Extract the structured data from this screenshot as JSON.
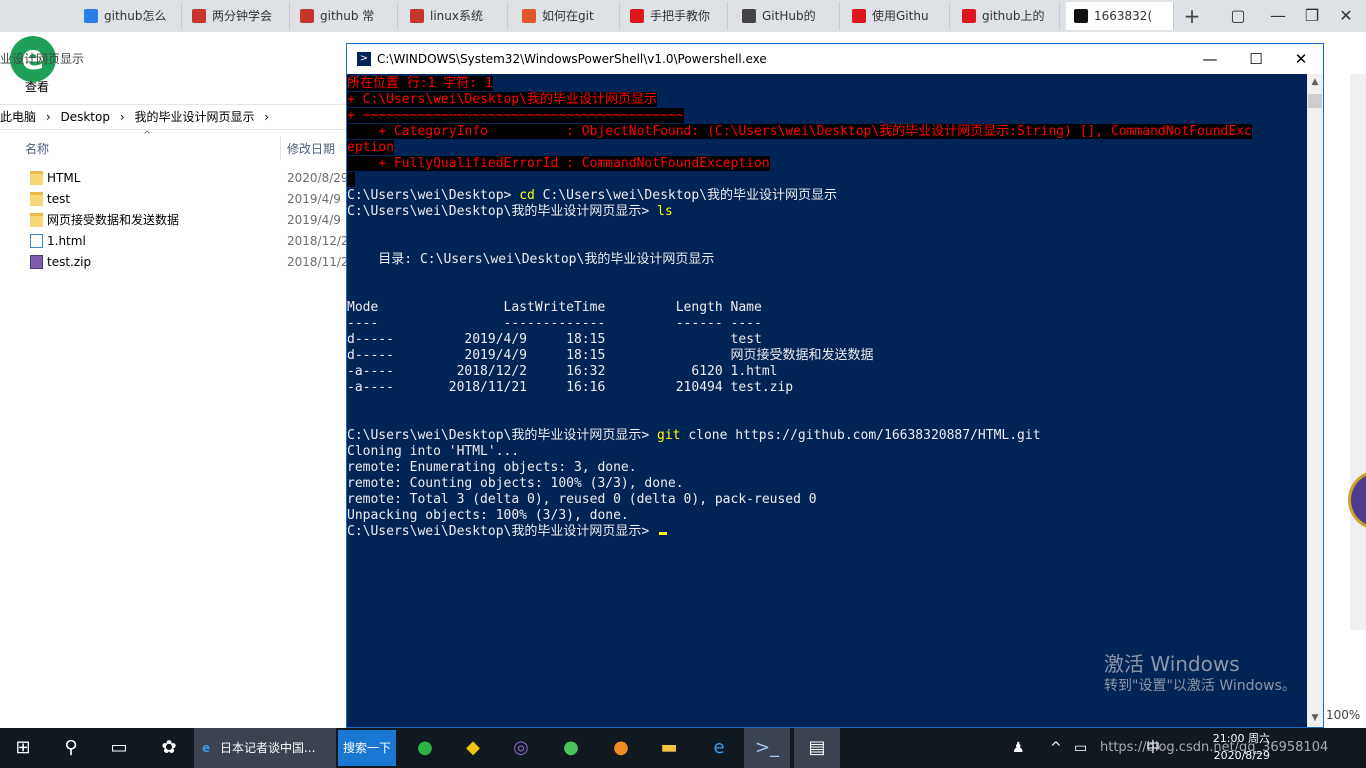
{
  "browser": {
    "tabs": [
      {
        "label": "github怎么",
        "color": "#2b7de9"
      },
      {
        "label": "两分钟学会",
        "color": "#c7372f"
      },
      {
        "label": "github 常",
        "color": "#c7372f"
      },
      {
        "label": "linux系统",
        "color": "#c7372f"
      },
      {
        "label": "如何在git",
        "color": "#e0582a"
      },
      {
        "label": "手把手教你",
        "color": "#e0161e"
      },
      {
        "label": "GitHub的",
        "color": "#444444"
      },
      {
        "label": "使用Githu",
        "color": "#e0161e"
      },
      {
        "label": "github上的",
        "color": "#e0161e"
      },
      {
        "label": "1663832(",
        "color": "#111111"
      }
    ],
    "new_tab": "+"
  },
  "explorer": {
    "title": "业设计网页显示",
    "ribbon_view": "查看",
    "breadcrumb": [
      "此电脑",
      "›",
      "Desktop",
      "›",
      "我的毕业设计网页显示",
      "›"
    ],
    "col_name": "名称",
    "col_date": "修改日期",
    "files": [
      {
        "name": "HTML",
        "date": "2020/8/29",
        "type": "folder"
      },
      {
        "name": "test",
        "date": "2019/4/9",
        "type": "folder"
      },
      {
        "name": "网页接受数据和发送数据",
        "date": "2019/4/9",
        "type": "folder"
      },
      {
        "name": "1.html",
        "date": "2018/12/2",
        "type": "html"
      },
      {
        "name": "test.zip",
        "date": "2018/11/2",
        "type": "zip"
      }
    ]
  },
  "powershell": {
    "title": "C:\\WINDOWS\\System32\\WindowsPowerShell\\v1.0\\Powershell.exe",
    "lines": [
      {
        "t": "所在位置 行:1 字符: 1",
        "k": "err"
      },
      {
        "t": "+ C:\\Users\\wei\\Desktop\\我的毕业设计网页显示",
        "k": "err"
      },
      {
        "t": "+ ~~~~~~~~~~~~~~~~~~~~~~~~~~~~~~~~~~~~~~~~~",
        "k": "err"
      },
      {
        "t": "    + CategoryInfo          : ObjectNotFound: (C:\\Users\\wei\\Desktop\\我的毕业设计网页显示:String) [], CommandNotFoundExc",
        "k": "err"
      },
      {
        "t": "eption",
        "k": "err"
      },
      {
        "t": "    + FullyQualifiedErrorId : CommandNotFoundException",
        "k": "err"
      },
      {
        "t": " ",
        "k": "err"
      },
      {
        "t": "",
        "k": "prompt",
        "p": "C:\\Users\\wei\\Desktop> ",
        "c": "cd",
        "a": " C:\\Users\\wei\\Desktop\\我的毕业设计网页显示"
      },
      {
        "t": "",
        "k": "prompt",
        "p": "C:\\Users\\wei\\Desktop\\我的毕业设计网页显示> ",
        "c": "ls",
        "a": ""
      },
      {
        "t": "",
        "k": "out"
      },
      {
        "t": "",
        "k": "out"
      },
      {
        "t": "    目录: C:\\Users\\wei\\Desktop\\我的毕业设计网页显示",
        "k": "out"
      },
      {
        "t": "",
        "k": "out"
      },
      {
        "t": "",
        "k": "out"
      },
      {
        "t": "Mode                LastWriteTime         Length Name",
        "k": "out"
      },
      {
        "t": "----                -------------         ------ ----",
        "k": "out"
      },
      {
        "t": "d-----         2019/4/9     18:15                test",
        "k": "out"
      },
      {
        "t": "d-----         2019/4/9     18:15                网页接受数据和发送数据",
        "k": "out"
      },
      {
        "t": "-a----        2018/12/2     16:32           6120 1.html",
        "k": "out"
      },
      {
        "t": "-a----       2018/11/21     16:16         210494 test.zip",
        "k": "out"
      },
      {
        "t": "",
        "k": "out"
      },
      {
        "t": "",
        "k": "out"
      },
      {
        "t": "",
        "k": "prompt",
        "p": "C:\\Users\\wei\\Desktop\\我的毕业设计网页显示> ",
        "c": "git",
        "a": " clone https://github.com/16638320887/HTML.git"
      },
      {
        "t": "Cloning into 'HTML'...",
        "k": "out"
      },
      {
        "t": "remote: Enumerating objects: 3, done.",
        "k": "out"
      },
      {
        "t": "remote: Counting objects: 100% (3/3), done.",
        "k": "out"
      },
      {
        "t": "remote: Total 3 (delta 0), reused 0 (delta 0), pack-reused 0",
        "k": "out"
      },
      {
        "t": "Unpacking objects: 100% (3/3), done.",
        "k": "out"
      },
      {
        "t": "",
        "k": "prompt",
        "p": "C:\\Users\\wei\\Desktop\\我的毕业设计网页显示> ",
        "c": "",
        "a": "",
        "cursor": true
      }
    ]
  },
  "watermark": {
    "line1": "激活 Windows",
    "line2": "转到\"设置\"以激活 Windows。"
  },
  "zoom": "100%",
  "taskbar": {
    "ie_label": "日本记者谈中国...",
    "search_label": "搜索一下",
    "tray_ime": "中",
    "clock_time": "21:00 周六",
    "clock_date": "2020/8/29",
    "url_watermark": "https://blog.csdn.net/qq_36958104"
  }
}
